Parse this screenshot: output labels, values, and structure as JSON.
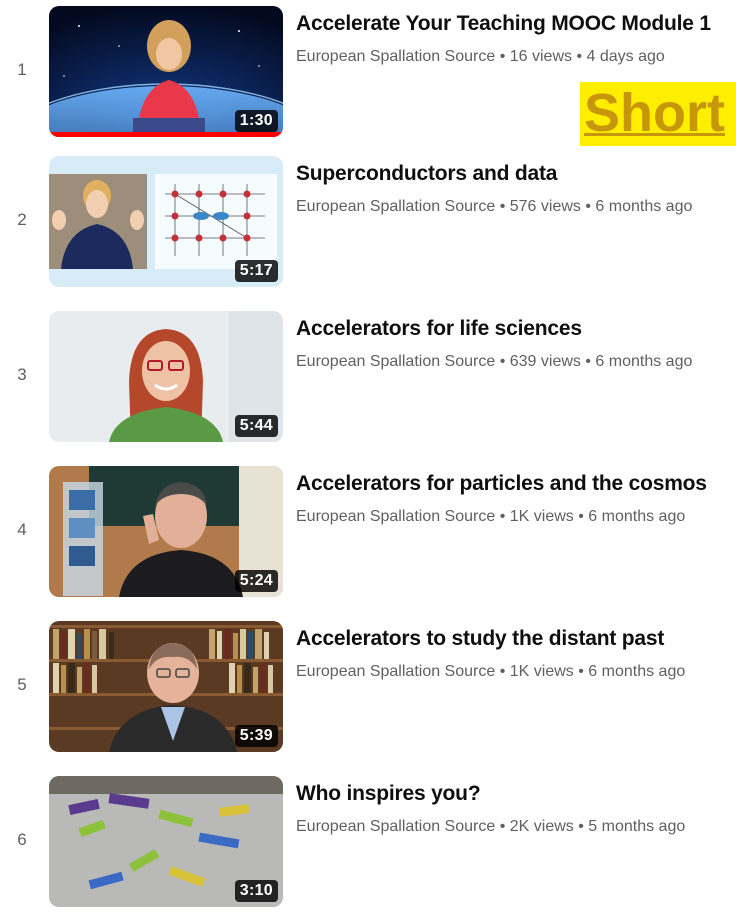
{
  "playlist": {
    "items": [
      {
        "index": "1",
        "title": "Accelerate Your Teaching MOOC Module 1",
        "channel": "European Spallation Source",
        "views": "16 views",
        "age": "4 days ago",
        "duration": "1:30",
        "watched_fraction": 1.0
      },
      {
        "index": "2",
        "title": "Superconductors and data",
        "channel": "European Spallation Source",
        "views": "576 views",
        "age": "6 months ago",
        "duration": "5:17"
      },
      {
        "index": "3",
        "title": "Accelerators for life sciences",
        "channel": "European Spallation Source",
        "views": "639 views",
        "age": "6 months ago",
        "duration": "5:44"
      },
      {
        "index": "4",
        "title": "Accelerators for particles and the cosmos",
        "channel": "European Spallation Source",
        "views": "1K views",
        "age": "6 months ago",
        "duration": "5:24"
      },
      {
        "index": "5",
        "title": "Accelerators to study the distant past",
        "channel": "European Spallation Source",
        "views": "1K views",
        "age": "6 months ago",
        "duration": "5:39"
      },
      {
        "index": "6",
        "title": "Who inspires you?",
        "channel": "European Spallation Source",
        "views": "2K views",
        "age": "5 months ago",
        "duration": "3:10"
      }
    ],
    "separator": " • "
  },
  "overlay": {
    "shorts_label": "Short"
  },
  "colors": {
    "title": "#0f0f0f",
    "meta": "#606060",
    "progress": "#ff0000",
    "highlight": "#ffee00",
    "highlight_text": "#c8960a"
  }
}
